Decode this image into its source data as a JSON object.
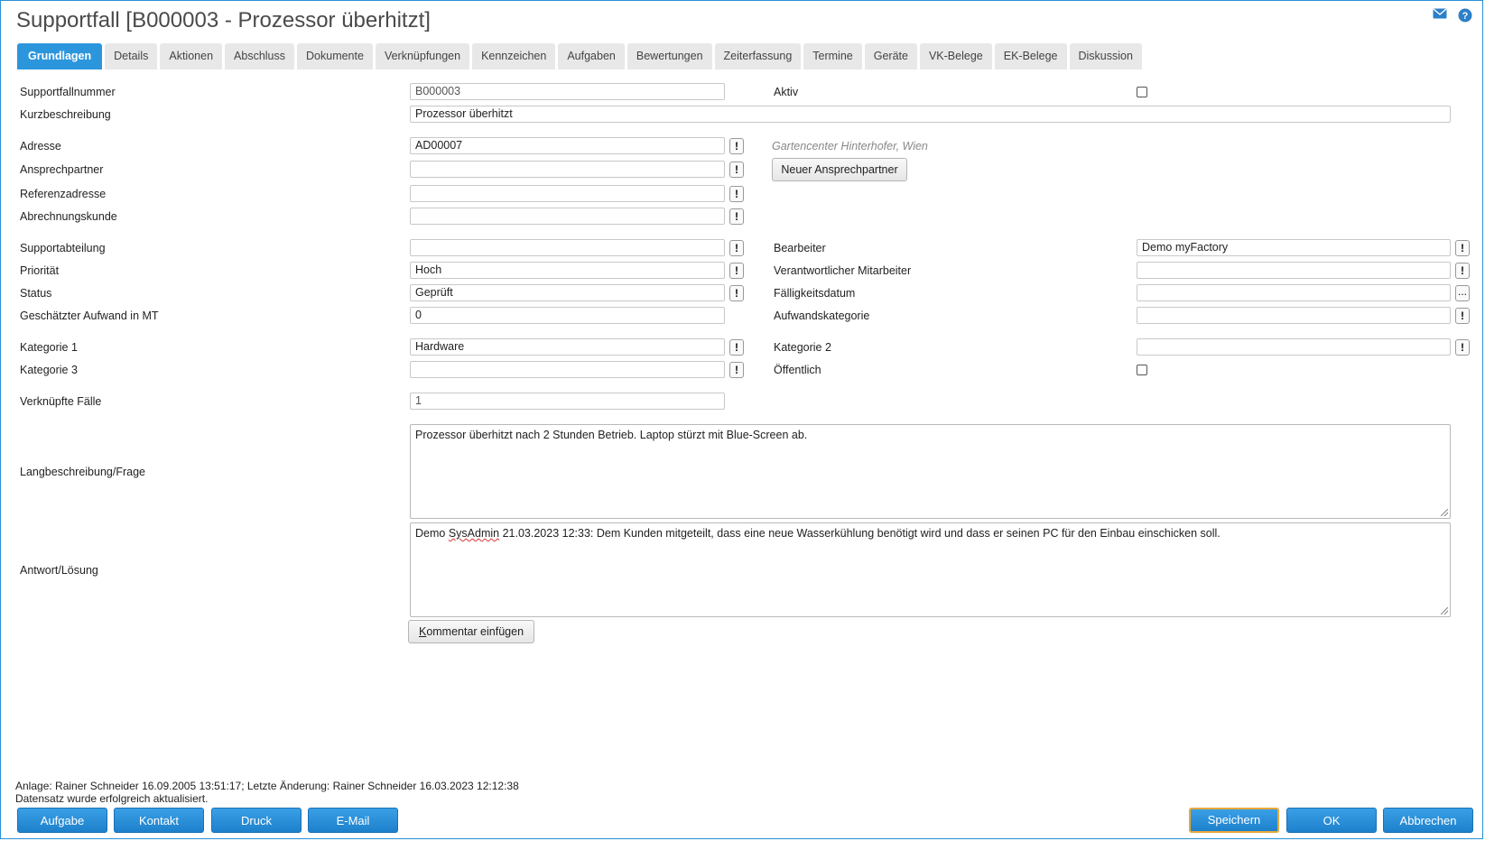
{
  "title": "Supportfall [B000003 - Prozessor überhitzt]",
  "icons": {
    "mail": "mail-icon",
    "help": "help-icon"
  },
  "tabs": [
    "Grundlagen",
    "Details",
    "Aktionen",
    "Abschluss",
    "Dokumente",
    "Verknüpfungen",
    "Kennzeichen",
    "Aufgaben",
    "Bewertungen",
    "Zeiterfassung",
    "Termine",
    "Geräte",
    "VK-Belege",
    "EK-Belege",
    "Diskussion"
  ],
  "labels": {
    "supportfallnummer": "Supportfallnummer",
    "aktiv": "Aktiv",
    "kurzbeschreibung": "Kurzbeschreibung",
    "adresse": "Adresse",
    "ansprechpartner": "Ansprechpartner",
    "referenzadresse": "Referenzadresse",
    "abrechnungskunde": "Abrechnungskunde",
    "supportabteilung": "Supportabteilung",
    "bearbeiter": "Bearbeiter",
    "prioritaet": "Priorität",
    "verantwortlicher": "Verantwortlicher Mitarbeiter",
    "status": "Status",
    "faelligkeitsdatum": "Fälligkeitsdatum",
    "aufwand": "Geschätzter Aufwand in MT",
    "aufwandskategorie": "Aufwandskategorie",
    "kategorie1": "Kategorie 1",
    "kategorie2": "Kategorie 2",
    "kategorie3": "Kategorie 3",
    "oeffentlich": "Öffentlich",
    "verknuepfte": "Verknüpfte Fälle",
    "langbeschreibung": "Langbeschreibung/Frage",
    "antwort": "Antwort/Lösung"
  },
  "values": {
    "supportfallnummer": "B000003",
    "kurzbeschreibung": "Prozessor überhitzt",
    "adresse": "AD00007",
    "adresse_hint": "Gartencenter Hinterhofer, Wien",
    "ansprechpartner": "",
    "referenzadresse": "",
    "abrechnungskunde": "",
    "supportabteilung": "",
    "bearbeiter": "Demo myFactory",
    "prioritaet": "Hoch",
    "verantwortlicher": "",
    "status": "Geprüft",
    "faelligkeitsdatum": "",
    "aufwand": "0",
    "aufwandskategorie": "",
    "kategorie1": "Hardware",
    "kategorie2": "",
    "kategorie3": "",
    "verknuepfte": "1",
    "langbeschreibung": "Prozessor überhitzt nach 2 Stunden Betrieb. Laptop stürzt mit Blue-Screen ab.",
    "antwort_prefix": "Demo ",
    "antwort_user": "SysAdmin",
    "antwort_rest": " 21.03.2023 12:33: Dem Kunden mitgeteilt, dass eine neue Wasserkühlung benötigt wird und dass er seinen PC für den Einbau einschicken soll.",
    "aktiv": false,
    "oeffentlich": false
  },
  "buttons": {
    "neuer_ansprechpartner": "Neuer Ansprechpartner",
    "kommentar_first": "K",
    "kommentar_rest": "ommentar einfügen",
    "lookup": "!",
    "date_picker": "...",
    "aufgabe": "Aufgabe",
    "kontakt": "Kontakt",
    "druck": "Druck",
    "email": "E-Mail",
    "speichern": "Speichern",
    "ok": "OK",
    "abbrechen": "Abbrechen"
  },
  "status": {
    "line1": "Anlage: Rainer Schneider 16.09.2005 13:51:17; Letzte Änderung: Rainer Schneider 16.03.2023 12:12:38",
    "line2": "Datensatz wurde erfolgreich aktualisiert."
  },
  "colors": {
    "accent": "#2c96dd",
    "primary_border": "#e8a73a"
  }
}
